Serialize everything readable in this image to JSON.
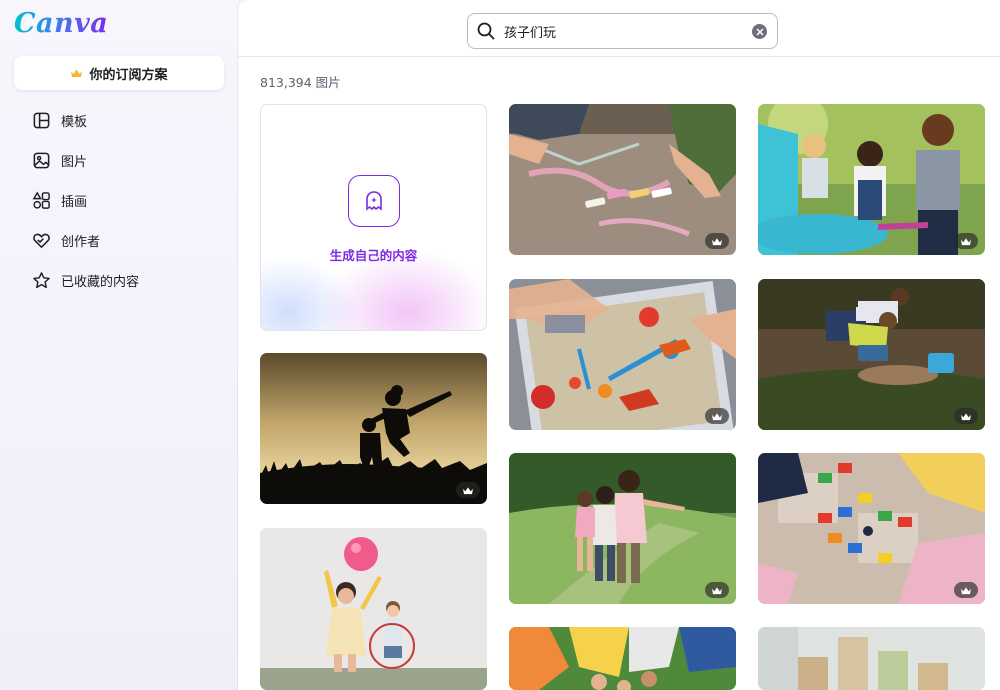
{
  "app": {
    "logo_text": "Canva"
  },
  "sidebar": {
    "plan_label": "你的订阅方案",
    "items": [
      {
        "label": "模板",
        "icon": "template-icon"
      },
      {
        "label": "图片",
        "icon": "image-icon"
      },
      {
        "label": "插画",
        "icon": "shapes-icon"
      },
      {
        "label": "创作者",
        "icon": "heart-hands-icon"
      },
      {
        "label": "已收藏的内容",
        "icon": "star-icon"
      }
    ]
  },
  "search": {
    "value": "孩子们玩",
    "placeholder": ""
  },
  "results": {
    "count_text": "813,394 图片",
    "generate_label": "生成自己的内容"
  },
  "colors": {
    "brand_purple": "#7d2ae8",
    "brand_teal": "#00c4cc"
  }
}
